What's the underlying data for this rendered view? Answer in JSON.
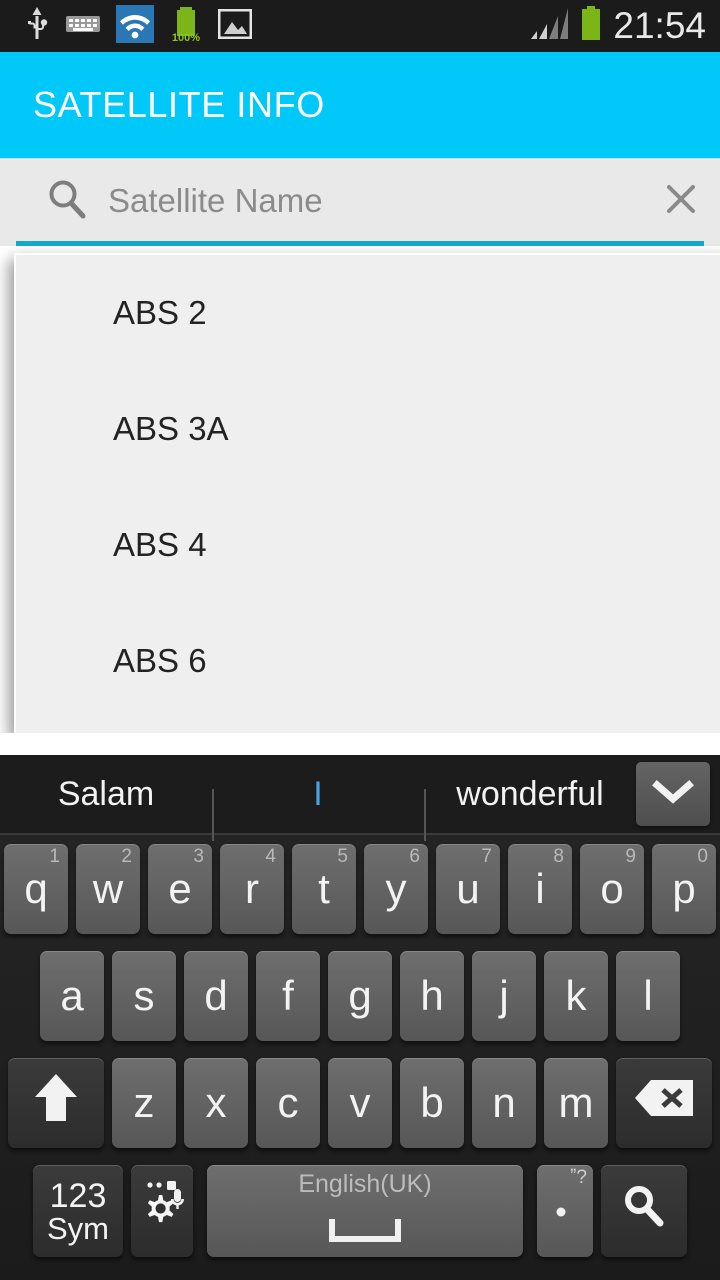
{
  "statusbar": {
    "time": "21:54",
    "battery_percent": "100%",
    "left_icons": [
      "usb-icon",
      "keyboard-icon",
      "wifi-icon",
      "battery-charge-icon",
      "image-icon"
    ],
    "right_icons": [
      "signal-icon",
      "battery-icon"
    ]
  },
  "actionbar": {
    "title": "SATELLITE INFO",
    "color": "#00c8f8"
  },
  "search": {
    "placeholder": "Satellite Name",
    "value": "",
    "clear_label": "✕",
    "underline_color": "#18a8c8"
  },
  "dropdown": {
    "items": [
      {
        "label": "ABS 2"
      },
      {
        "label": "ABS 3A"
      },
      {
        "label": "ABS 4"
      },
      {
        "label": "ABS 6"
      }
    ]
  },
  "keyboard": {
    "suggestions": [
      {
        "text": "Salam",
        "active": false
      },
      {
        "text": "I",
        "active": true
      },
      {
        "text": "wonderful",
        "active": false
      }
    ],
    "expand_icon": "chevron-down-icon",
    "row1": [
      {
        "key": "q",
        "hint": "1"
      },
      {
        "key": "w",
        "hint": "2"
      },
      {
        "key": "e",
        "hint": "3"
      },
      {
        "key": "r",
        "hint": "4"
      },
      {
        "key": "t",
        "hint": "5"
      },
      {
        "key": "y",
        "hint": "6"
      },
      {
        "key": "u",
        "hint": "7"
      },
      {
        "key": "i",
        "hint": "8"
      },
      {
        "key": "o",
        "hint": "9"
      },
      {
        "key": "p",
        "hint": "0"
      }
    ],
    "row2": [
      {
        "key": "a"
      },
      {
        "key": "s"
      },
      {
        "key": "d"
      },
      {
        "key": "f"
      },
      {
        "key": "g"
      },
      {
        "key": "h"
      },
      {
        "key": "j"
      },
      {
        "key": "k"
      },
      {
        "key": "l"
      }
    ],
    "row3": [
      {
        "key": "z"
      },
      {
        "key": "x"
      },
      {
        "key": "c"
      },
      {
        "key": "v"
      },
      {
        "key": "b"
      },
      {
        "key": "n"
      },
      {
        "key": "m"
      }
    ],
    "shift": {
      "icon": "shift-arrow-up-icon"
    },
    "backspace": {
      "icon": "backspace-icon"
    },
    "sym": {
      "line1": "123",
      "line2": "Sym"
    },
    "settings": {
      "icon": "gear-mic-icon"
    },
    "space": {
      "language": "English(UK)",
      "icon": "spacebar-icon"
    },
    "period": {
      "hint": "ˮ?",
      "key": "."
    },
    "searchkey": {
      "icon": "search-icon"
    }
  }
}
